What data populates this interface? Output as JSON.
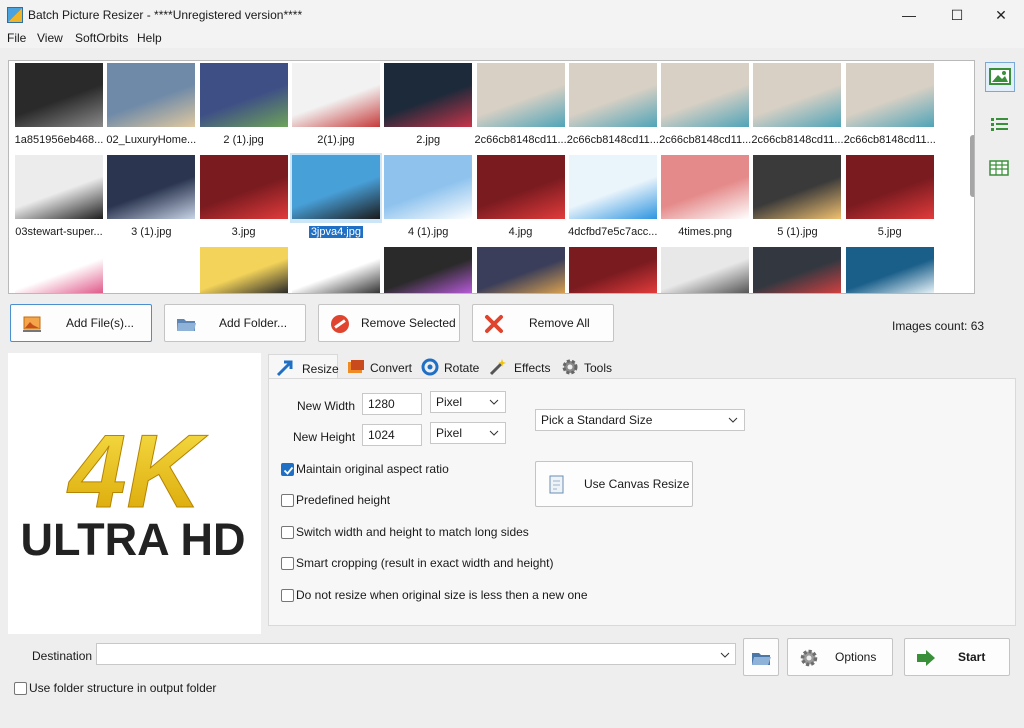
{
  "window": {
    "title": "Batch Picture Resizer - ****Unregistered version****",
    "minimize_glyph": "—",
    "maximize_glyph": "☐",
    "close_glyph": "✕"
  },
  "menu": {
    "items": [
      "File",
      "View",
      "SoftOrbits",
      "Help"
    ]
  },
  "gallery": {
    "rows": [
      [
        "1a851956eb468...",
        "02_LuxuryHome...",
        "2 (1).jpg",
        "2(1).jpg",
        "2.jpg",
        "2c66cb8148cd11...",
        "2c66cb8148cd11...",
        "2c66cb8148cd11...",
        "2c66cb8148cd11...",
        "2c66cb8148cd11..."
      ],
      [
        "03stewart-super...",
        "3 (1).jpg",
        "3.jpg",
        "3jpva4.jpg",
        "4 (1).jpg",
        "4.jpg",
        "4dcfbd7e5c7acc...",
        "4times.png",
        "5 (1).jpg",
        "5.jpg"
      ]
    ],
    "selected_file": "3jpva4.jpg",
    "third_row_visible": 10
  },
  "toolbar": {
    "add_files": "Add File(s)...",
    "add_folder": "Add Folder...",
    "remove_selected": "Remove Selected",
    "remove_all": "Remove All"
  },
  "images_count": "Images count: 63",
  "preview": {
    "line1": "4K",
    "line2": "ULTRA HD"
  },
  "tabs": [
    "Resize",
    "Convert",
    "Rotate",
    "Effects",
    "Tools"
  ],
  "resize": {
    "new_width_label": "New Width",
    "new_width_value": "1280",
    "new_width_unit": "Pixel",
    "new_height_label": "New Height",
    "new_height_value": "1024",
    "new_height_unit": "Pixel",
    "standard_size": "Pick a Standard Size",
    "canvas_resize": "Use Canvas Resize",
    "options": [
      {
        "label": "Maintain original aspect ratio",
        "checked": true
      },
      {
        "label": "Predefined height",
        "checked": false
      },
      {
        "label": "Switch width and height to match long sides",
        "checked": false
      },
      {
        "label": "Smart cropping (result in exact width and height)",
        "checked": false
      },
      {
        "label": "Do not resize when original size is less then a new one",
        "checked": false
      }
    ]
  },
  "destination": {
    "label": "Destination",
    "value": ""
  },
  "bottom": {
    "options": "Options",
    "start": "Start",
    "folder_structure": "Use folder structure in output folder",
    "folder_structure_checked": false
  },
  "colors": {
    "accent": "#1f6fc5",
    "gold": "#f2c200",
    "red_icon": "#e0442e",
    "green_icon": "#3a8f3a"
  }
}
